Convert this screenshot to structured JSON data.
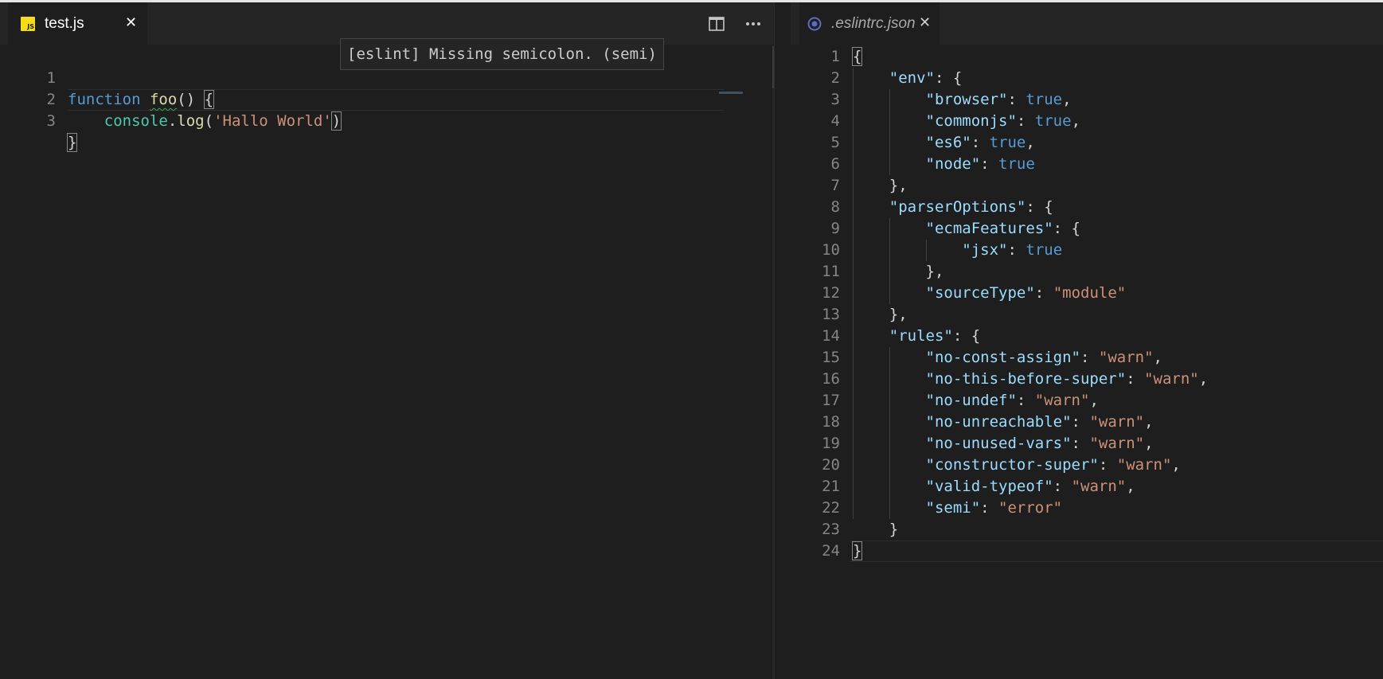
{
  "colors": {
    "background": "#1e1e1e",
    "tab_bar": "#252526",
    "keyword": "#569cd6",
    "function": "#dcdcaa",
    "string": "#ce9178",
    "property": "#9cdcfe",
    "variable": "#4ec9b0",
    "line_number": "#858585",
    "js_icon": "#f5de19",
    "json_icon": "#5c6bc0"
  },
  "left_editor": {
    "tab": {
      "label": "test.js",
      "icon": "js-file-icon",
      "icon_text": "JS",
      "close": "✕"
    },
    "actions": {
      "split": "split-editor-icon",
      "more": "more-actions-icon"
    },
    "hover_message": "[eslint] Missing semicolon. (semi)",
    "lines": [
      {
        "number": "1",
        "tokens": [
          "function",
          "foo",
          "()",
          "{"
        ]
      },
      {
        "number": "2",
        "tokens": [
          "console",
          ".",
          "log",
          "(",
          "'Hallo World'",
          ")"
        ]
      },
      {
        "number": "3",
        "tokens": [
          "}"
        ]
      }
    ]
  },
  "right_editor": {
    "tab": {
      "label": ".eslintrc.json",
      "icon": "json-settings-icon",
      "close": "✕"
    },
    "lines": [
      {
        "number": "1",
        "tokens": [
          "{"
        ]
      },
      {
        "number": "2",
        "tokens": [
          "\"env\"",
          ": {"
        ]
      },
      {
        "number": "3",
        "tokens": [
          "\"browser\"",
          ": ",
          "true",
          ","
        ]
      },
      {
        "number": "4",
        "tokens": [
          "\"commonjs\"",
          ": ",
          "true",
          ","
        ]
      },
      {
        "number": "5",
        "tokens": [
          "\"es6\"",
          ": ",
          "true",
          ","
        ]
      },
      {
        "number": "6",
        "tokens": [
          "\"node\"",
          ": ",
          "true"
        ]
      },
      {
        "number": "7",
        "tokens": [
          "},"
        ]
      },
      {
        "number": "8",
        "tokens": [
          "\"parserOptions\"",
          ": {"
        ]
      },
      {
        "number": "9",
        "tokens": [
          "\"ecmaFeatures\"",
          ": {"
        ]
      },
      {
        "number": "10",
        "tokens": [
          "\"jsx\"",
          ": ",
          "true"
        ]
      },
      {
        "number": "11",
        "tokens": [
          "},"
        ]
      },
      {
        "number": "12",
        "tokens": [
          "\"sourceType\"",
          ": ",
          "\"module\""
        ]
      },
      {
        "number": "13",
        "tokens": [
          "},"
        ]
      },
      {
        "number": "14",
        "tokens": [
          "\"rules\"",
          ": {"
        ]
      },
      {
        "number": "15",
        "tokens": [
          "\"no-const-assign\"",
          ": ",
          "\"warn\"",
          ","
        ]
      },
      {
        "number": "16",
        "tokens": [
          "\"no-this-before-super\"",
          ": ",
          "\"warn\"",
          ","
        ]
      },
      {
        "number": "17",
        "tokens": [
          "\"no-undef\"",
          ": ",
          "\"warn\"",
          ","
        ]
      },
      {
        "number": "18",
        "tokens": [
          "\"no-unreachable\"",
          ": ",
          "\"warn\"",
          ","
        ]
      },
      {
        "number": "19",
        "tokens": [
          "\"no-unused-vars\"",
          ": ",
          "\"warn\"",
          ","
        ]
      },
      {
        "number": "20",
        "tokens": [
          "\"constructor-super\"",
          ": ",
          "\"warn\"",
          ","
        ]
      },
      {
        "number": "21",
        "tokens": [
          "\"valid-typeof\"",
          ": ",
          "\"warn\"",
          ","
        ]
      },
      {
        "number": "22",
        "tokens": [
          "\"semi\"",
          ": ",
          "\"error\""
        ]
      },
      {
        "number": "23",
        "tokens": [
          "}"
        ]
      },
      {
        "number": "24",
        "tokens": [
          "}"
        ]
      }
    ]
  }
}
